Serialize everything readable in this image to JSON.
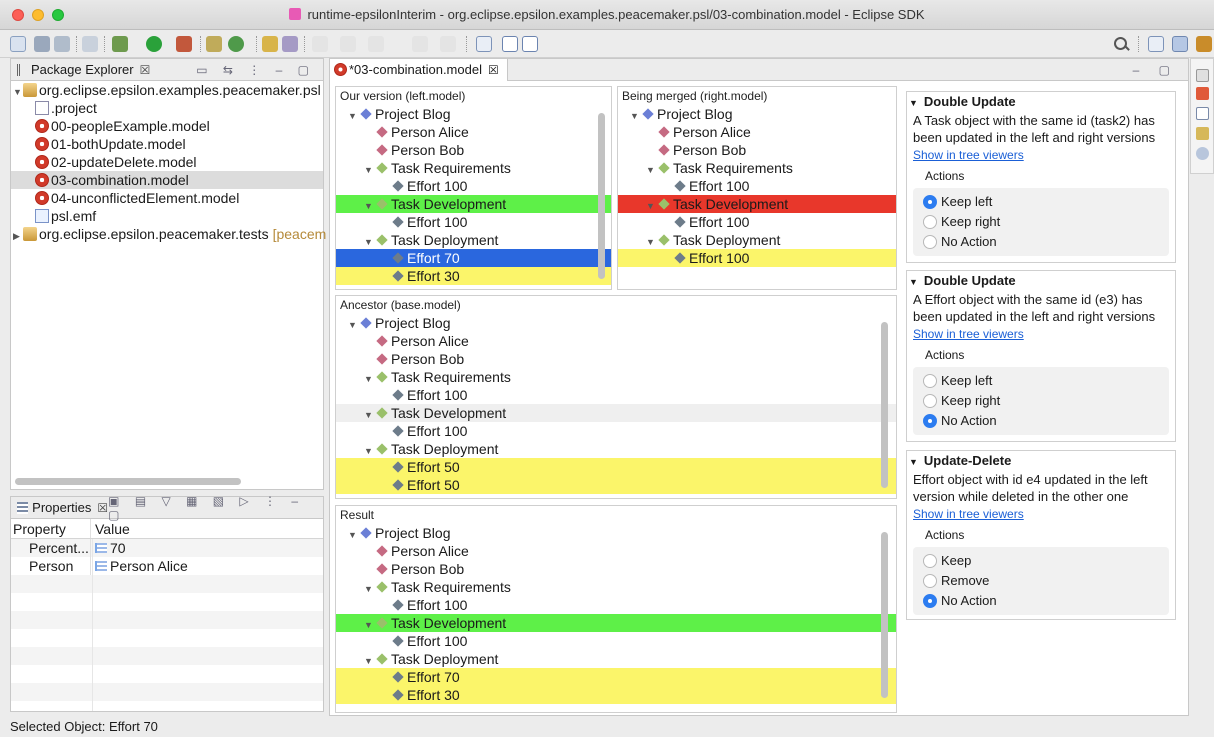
{
  "window": {
    "title": "runtime-epsilonInterim - org.eclipse.epsilon.examples.peacemaker.psl/03-combination.model - Eclipse SDK"
  },
  "package_explorer": {
    "tab_label": "Package Explorer",
    "close": "☒",
    "items": [
      {
        "label": "org.eclipse.epsilon.examples.peacemaker.psl",
        "icon": "project-icon",
        "expanded": true,
        "level": 0
      },
      {
        "label": ".project",
        "icon": "file-icon",
        "level": 1
      },
      {
        "label": "00-peopleExample.model",
        "icon": "model-icon",
        "level": 1
      },
      {
        "label": "01-bothUpdate.model",
        "icon": "model-icon",
        "level": 1
      },
      {
        "label": "02-updateDelete.model",
        "icon": "model-icon",
        "level": 1
      },
      {
        "label": "03-combination.model",
        "icon": "model-icon",
        "level": 1,
        "selected": true
      },
      {
        "label": "04-unconflictedElement.model",
        "icon": "model-icon",
        "level": 1
      },
      {
        "label": "psl.emf",
        "icon": "emf-icon",
        "level": 1
      },
      {
        "label": "org.eclipse.epsilon.peacemaker.tests",
        "suffix": "[peacem",
        "icon": "project-icon",
        "expanded": false,
        "level": 0
      }
    ]
  },
  "properties": {
    "tab_label": "Properties",
    "close": "☒",
    "col_property": "Property",
    "col_value": "Value",
    "rows": [
      {
        "property": "Percent...",
        "value": "70"
      },
      {
        "property": "Person",
        "value": "Person Alice"
      }
    ]
  },
  "status": {
    "text": "Selected Object: Effort 70"
  },
  "editor": {
    "tab_label": "*03-combination.model",
    "close": "☒",
    "panes": {
      "left": {
        "title": "Our version (left.model)",
        "rows": [
          {
            "label": "Project Blog",
            "kind": "project",
            "level": 0,
            "twisty": "▼"
          },
          {
            "label": "Person Alice",
            "kind": "person",
            "level": 1
          },
          {
            "label": "Person Bob",
            "kind": "person",
            "level": 1
          },
          {
            "label": "Task Requirements",
            "kind": "task",
            "level": 1,
            "twisty": "▼"
          },
          {
            "label": "Effort 100",
            "kind": "effort",
            "level": 2
          },
          {
            "label": "Task Development",
            "kind": "task",
            "level": 1,
            "twisty": "▼",
            "hl": "green"
          },
          {
            "label": "Effort 100",
            "kind": "effort",
            "level": 2
          },
          {
            "label": "Task Deployment",
            "kind": "task",
            "level": 1,
            "twisty": "▼"
          },
          {
            "label": "Effort 70",
            "kind": "effort",
            "level": 2,
            "hl": "blue"
          },
          {
            "label": "Effort 30",
            "kind": "effort",
            "level": 2,
            "hl": "yellow"
          }
        ]
      },
      "right": {
        "title": "Being merged (right.model)",
        "rows": [
          {
            "label": "Project Blog",
            "kind": "project",
            "level": 0,
            "twisty": "▼"
          },
          {
            "label": "Person Alice",
            "kind": "person",
            "level": 1
          },
          {
            "label": "Person Bob",
            "kind": "person",
            "level": 1
          },
          {
            "label": "Task Requirements",
            "kind": "task",
            "level": 1,
            "twisty": "▼"
          },
          {
            "label": "Effort 100",
            "kind": "effort",
            "level": 2
          },
          {
            "label": "Task Development",
            "kind": "task",
            "level": 1,
            "twisty": "▼",
            "hl": "red"
          },
          {
            "label": "Effort 100",
            "kind": "effort",
            "level": 2
          },
          {
            "label": "Task Deployment",
            "kind": "task",
            "level": 1,
            "twisty": "▼"
          },
          {
            "label": "Effort 100",
            "kind": "effort",
            "level": 2,
            "hl": "yellow"
          }
        ]
      },
      "ancestor": {
        "title": "Ancestor (base.model)",
        "rows": [
          {
            "label": "Project Blog",
            "kind": "project",
            "level": 0,
            "twisty": "▼"
          },
          {
            "label": "Person Alice",
            "kind": "person",
            "level": 1
          },
          {
            "label": "Person Bob",
            "kind": "person",
            "level": 1
          },
          {
            "label": "Task Requirements",
            "kind": "task",
            "level": 1,
            "twisty": "▼"
          },
          {
            "label": "Effort 100",
            "kind": "effort",
            "level": 2
          },
          {
            "label": "Task Development",
            "kind": "task",
            "level": 1,
            "twisty": "▼",
            "hl": "grey"
          },
          {
            "label": "Effort 100",
            "kind": "effort",
            "level": 2
          },
          {
            "label": "Task Deployment",
            "kind": "task",
            "level": 1,
            "twisty": "▼"
          },
          {
            "label": "Effort 50",
            "kind": "effort",
            "level": 2,
            "hl": "yellow"
          },
          {
            "label": "Effort 50",
            "kind": "effort",
            "level": 2,
            "hl": "yellow"
          }
        ]
      },
      "result": {
        "title": "Result",
        "rows": [
          {
            "label": "Project Blog",
            "kind": "project",
            "level": 0,
            "twisty": "▼"
          },
          {
            "label": "Person Alice",
            "kind": "person",
            "level": 1
          },
          {
            "label": "Person Bob",
            "kind": "person",
            "level": 1
          },
          {
            "label": "Task Requirements",
            "kind": "task",
            "level": 1,
            "twisty": "▼"
          },
          {
            "label": "Effort 100",
            "kind": "effort",
            "level": 2
          },
          {
            "label": "Task Development",
            "kind": "task",
            "level": 1,
            "twisty": "▼",
            "hl": "green"
          },
          {
            "label": "Effort 100",
            "kind": "effort",
            "level": 2
          },
          {
            "label": "Task Deployment",
            "kind": "task",
            "level": 1,
            "twisty": "▼"
          },
          {
            "label": "Effort 70",
            "kind": "effort",
            "level": 2,
            "hl": "yellow"
          },
          {
            "label": "Effort 30",
            "kind": "effort",
            "level": 2,
            "hl": "yellow"
          }
        ]
      }
    }
  },
  "conflicts": [
    {
      "title": "Double Update",
      "description": "A Task object with the same id (task2) has been updated in the left and right versions",
      "link": "Show in tree viewers",
      "actions_label": "Actions",
      "options": [
        {
          "label": "Keep left",
          "selected": true
        },
        {
          "label": "Keep right",
          "selected": false
        },
        {
          "label": "No Action",
          "selected": false
        }
      ]
    },
    {
      "title": "Double Update",
      "description": "A Effort object with the same id (e3) has been updated in the left and right versions",
      "link": "Show in tree viewers",
      "actions_label": "Actions",
      "options": [
        {
          "label": "Keep left",
          "selected": false
        },
        {
          "label": "Keep right",
          "selected": false
        },
        {
          "label": "No Action",
          "selected": true
        }
      ]
    },
    {
      "title": "Update-Delete",
      "description": "Effort object with id e4 updated in the left version while deleted in the other one",
      "link": "Show in tree viewers",
      "actions_label": "Actions",
      "options": [
        {
          "label": "Keep",
          "selected": false
        },
        {
          "label": "Remove",
          "selected": false
        },
        {
          "label": "No Action",
          "selected": true
        }
      ]
    }
  ],
  "colors": {
    "green": "#5ef048",
    "red": "#e8372b",
    "yellow": "#fbf56a",
    "blue": "#2a67de",
    "link": "#1a5fd6",
    "radio_on": "#2c7cf0"
  }
}
